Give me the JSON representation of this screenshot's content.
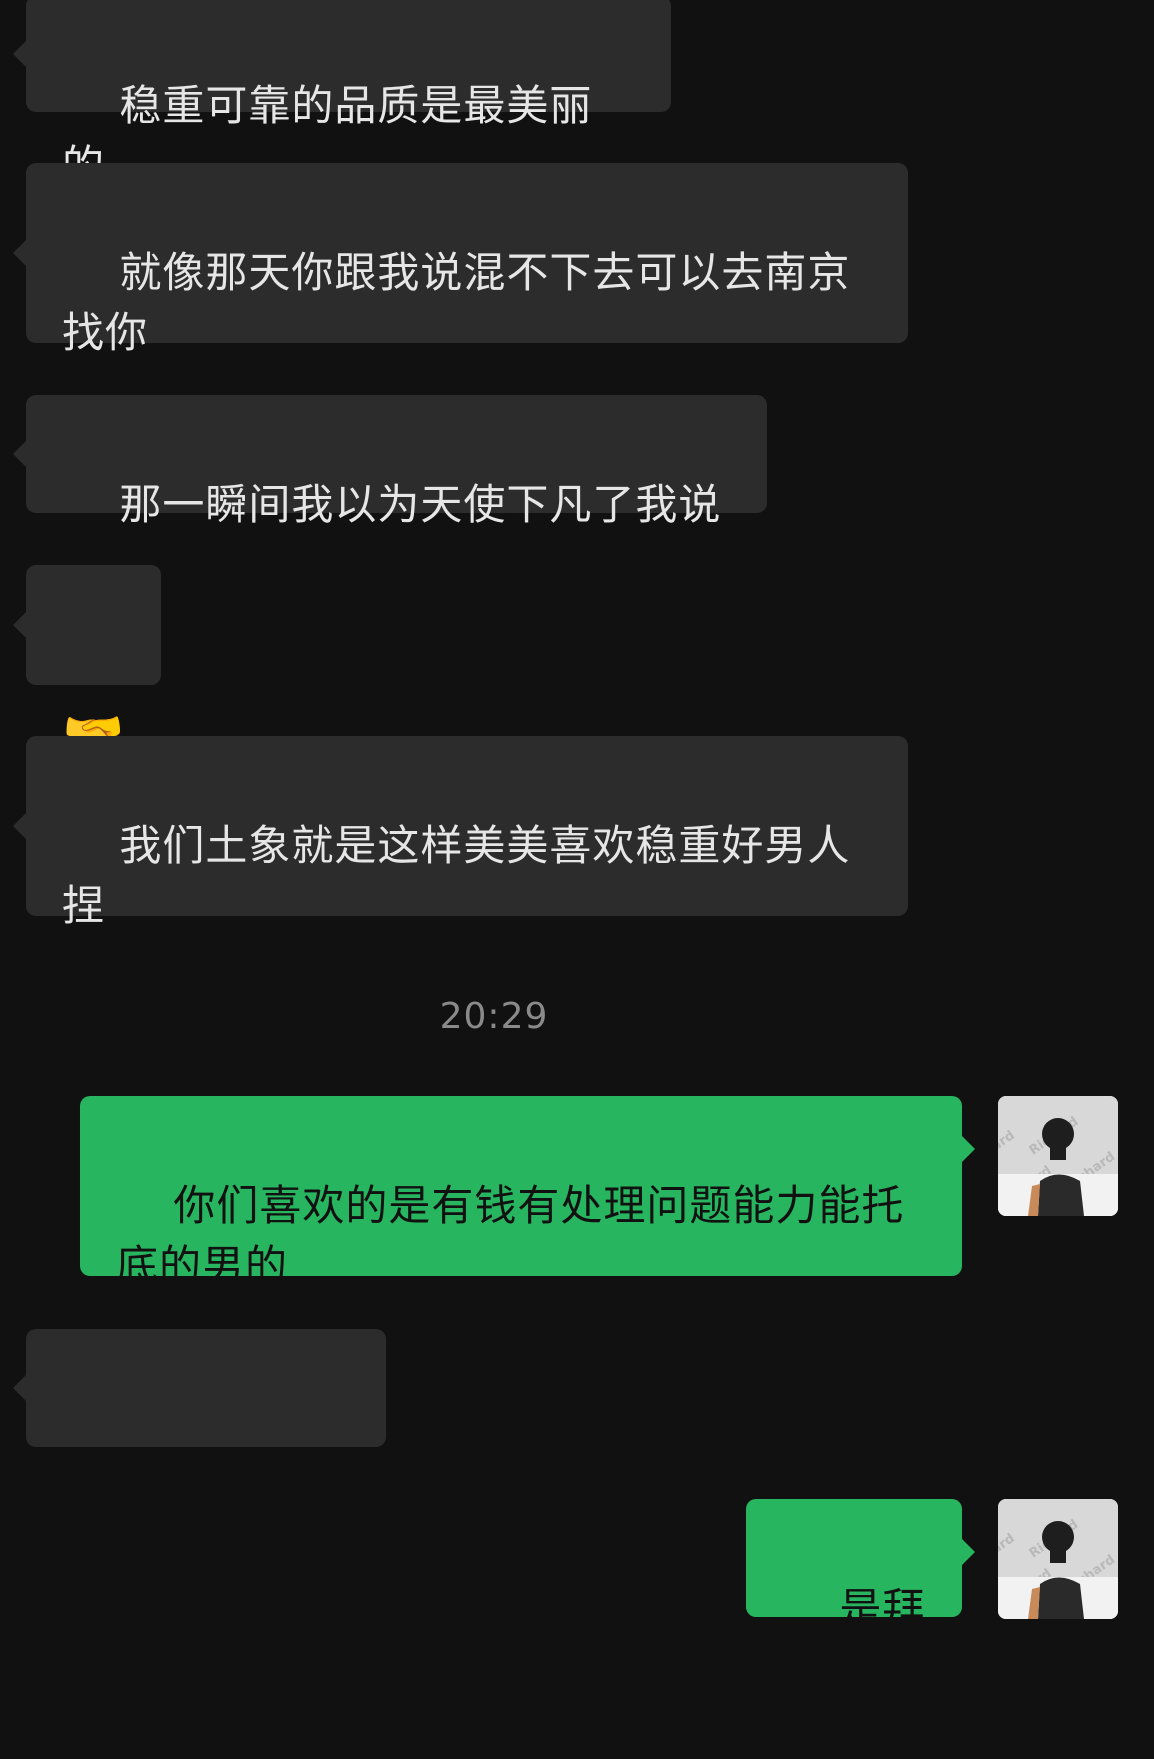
{
  "messages": [
    {
      "side": "in",
      "text": "稳重可靠的品质是最美丽的"
    },
    {
      "side": "in",
      "text": "就像那天你跟我说混不下去可以去南京\n找你"
    },
    {
      "side": "in",
      "text": "那一瞬间我以为天使下凡了我说"
    },
    {
      "side": "in",
      "text": "🤝"
    },
    {
      "side": "in",
      "text": "我们土象就是这样美美喜欢稳重好男人\n捏"
    },
    {
      "side": "out",
      "text": "你们喜欢的是有钱有处理问题能力能托\n底的男的"
    },
    {
      "side": "in",
      "text": "　　　　　　"
    },
    {
      "side": "out",
      "text": "是拜金"
    }
  ],
  "timestamp": "20:29",
  "avatar": {
    "watermark": "Richard"
  },
  "colors": {
    "background": "#111111",
    "incoming_bubble": "#2c2c2c",
    "outgoing_bubble": "#27b560",
    "timestamp": "#8a8a8a"
  }
}
